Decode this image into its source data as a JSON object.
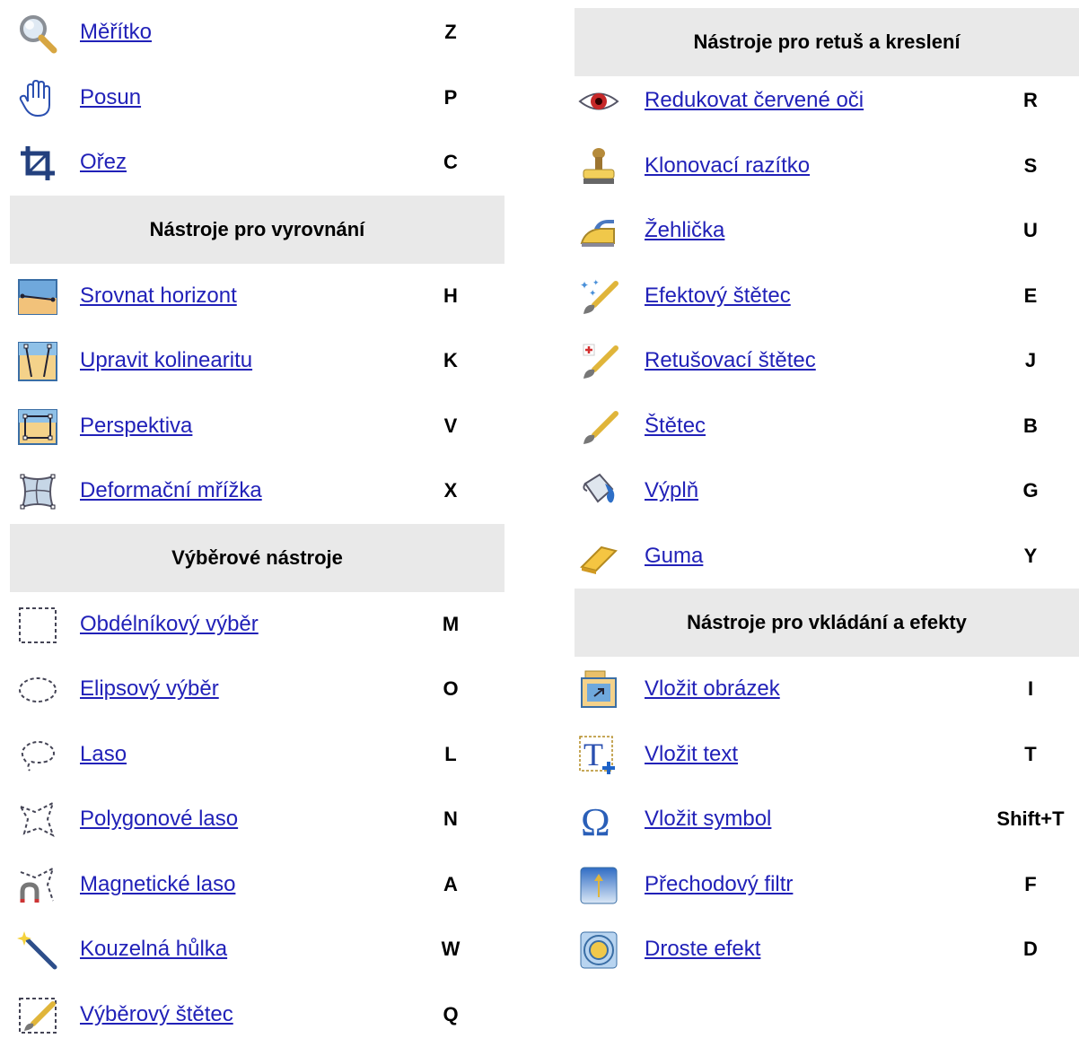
{
  "link_color": "#2121b8",
  "header_bg": "#e9e9e9",
  "left": {
    "rows": [
      {
        "label": "Měřítko",
        "key": "Z",
        "icon": "magnifier-icon"
      },
      {
        "label": "Posun",
        "key": "P",
        "icon": "hand-icon"
      },
      {
        "label": "Ořez",
        "key": "C",
        "icon": "crop-icon"
      }
    ],
    "align_header": "Nástroje pro vyrovnání",
    "align_rows": [
      {
        "label": "Srovnat horizont",
        "key": "H",
        "icon": "horizon-icon"
      },
      {
        "label": "Upravit kolinearitu",
        "key": "K",
        "icon": "collinearity-icon"
      },
      {
        "label": "Perspektiva",
        "key": "V",
        "icon": "perspective-icon"
      },
      {
        "label": "Deformační mřížka",
        "key": "X",
        "icon": "mesh-icon"
      }
    ],
    "select_header": "Výběrové nástroje",
    "select_rows": [
      {
        "label": "Obdélníkový výběr",
        "key": "M",
        "icon": "rect-select-icon"
      },
      {
        "label": "Elipsový výběr",
        "key": "O",
        "icon": "ellipse-select-icon"
      },
      {
        "label": "Laso",
        "key": "L",
        "icon": "lasso-icon"
      },
      {
        "label": "Polygonové laso",
        "key": "N",
        "icon": "polygon-lasso-icon"
      },
      {
        "label": "Magnetické laso",
        "key": "A",
        "icon": "magnetic-lasso-icon"
      },
      {
        "label": "Kouzelná hůlka",
        "key": "W",
        "icon": "magic-wand-icon"
      },
      {
        "label": "Výběrový štětec",
        "key": "Q",
        "icon": "selection-brush-icon"
      }
    ]
  },
  "right": {
    "retouch_header": "Nástroje pro retuš a kreslení",
    "retouch_rows": [
      {
        "label": "Redukovat červené oči",
        "key": "R",
        "icon": "red-eye-icon"
      },
      {
        "label": "Klonovací razítko",
        "key": "S",
        "icon": "clone-stamp-icon"
      },
      {
        "label": "Žehlička",
        "key": "U",
        "icon": "iron-icon"
      },
      {
        "label": "Efektový štětec",
        "key": "E",
        "icon": "effect-brush-icon"
      },
      {
        "label": "Retušovací štětec",
        "key": "J",
        "icon": "retouch-brush-icon"
      },
      {
        "label": "Štětec",
        "key": "B",
        "icon": "brush-icon"
      },
      {
        "label": "Výplň",
        "key": "G",
        "icon": "fill-bucket-icon"
      },
      {
        "label": "Guma",
        "key": "Y",
        "icon": "eraser-icon"
      }
    ],
    "insert_header": "Nástroje pro vkládání a efekty",
    "insert_rows": [
      {
        "label": "Vložit obrázek",
        "key": "I",
        "icon": "insert-image-icon"
      },
      {
        "label": "Vložit text",
        "key": "T",
        "icon": "insert-text-icon"
      },
      {
        "label": "Vložit symbol",
        "key": "Shift+T",
        "icon": "omega-icon"
      },
      {
        "label": "Přechodový filtr",
        "key": "F",
        "icon": "gradient-filter-icon"
      },
      {
        "label": "Droste efekt",
        "key": "D",
        "icon": "droste-icon"
      }
    ]
  }
}
